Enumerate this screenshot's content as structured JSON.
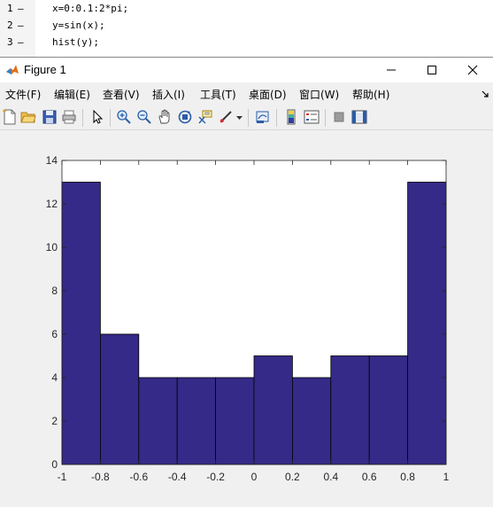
{
  "editor": {
    "lines": [
      {
        "num": "1",
        "dash": "–",
        "code": "x=0:0.1:2*pi;"
      },
      {
        "num": "2",
        "dash": "–",
        "code": "y=sin(x);"
      },
      {
        "num": "3",
        "dash": "–",
        "code": "hist(y);"
      }
    ]
  },
  "window": {
    "title": "Figure 1",
    "icons": {
      "logo": "matlab-logo-icon",
      "minimize": "minimize-icon",
      "maximize": "maximize-icon",
      "close": "close-icon"
    }
  },
  "menu": {
    "items": [
      "文件(F)",
      "编辑(E)",
      "查看(V)",
      "插入(I)",
      "工具(T)",
      "桌面(D)",
      "窗口(W)",
      "帮助(H)"
    ],
    "dock_icon": "dock-arrow-icon"
  },
  "toolbar": {
    "icons": [
      "new-figure-icon",
      "open-file-icon",
      "save-icon",
      "print-icon",
      "pointer-icon",
      "zoom-in-icon",
      "zoom-out-icon",
      "pan-icon",
      "rotate-3d-icon",
      "data-cursor-icon",
      "brush-icon",
      "brush-dropdown-icon",
      "link-plot-icon",
      "colorbar-icon",
      "legend-icon",
      "hide-plot-tools-icon",
      "show-plot-tools-icon"
    ]
  },
  "chart_data": {
    "type": "bar",
    "title": "",
    "xlabel": "",
    "ylabel": "",
    "bin_edges": [
      -1,
      -0.8,
      -0.6,
      -0.4,
      -0.2,
      0,
      0.2,
      0.4,
      0.6,
      0.8,
      1
    ],
    "values": [
      13,
      6,
      4,
      4,
      4,
      5,
      4,
      5,
      5,
      13
    ],
    "xlim": [
      -1,
      1
    ],
    "ylim": [
      0,
      14
    ],
    "xticks": [
      "-1",
      "-0.8",
      "-0.6",
      "-0.4",
      "-0.2",
      "0",
      "0.2",
      "0.4",
      "0.6",
      "0.8",
      "1"
    ],
    "yticks": [
      "0",
      "2",
      "4",
      "6",
      "8",
      "10",
      "12",
      "14"
    ],
    "bar_color": "#352a87",
    "edge_color": "#000000",
    "grid": false
  }
}
